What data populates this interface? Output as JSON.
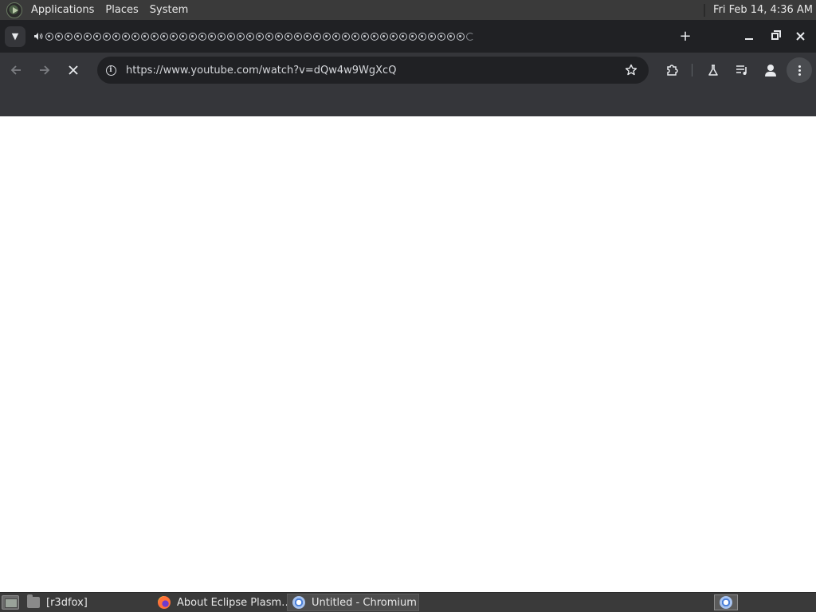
{
  "top_panel": {
    "menus": [
      "Applications",
      "Places",
      "System"
    ],
    "clock": "Fri Feb 14,  4:36 AM"
  },
  "browser": {
    "tab_search_icon": "chevron-down-icon",
    "new_tab_label": "+",
    "tab_count": 45,
    "window_controls": [
      "minimize-icon",
      "maximize-icon",
      "close-icon"
    ]
  },
  "toolbar": {
    "back_icon": "arrow-left-icon",
    "forward_icon": "arrow-right-icon",
    "stop_icon": "close-icon",
    "url": "https://www.youtube.com/watch?v=dQw4w9WgXcQ",
    "site_info_icon": "info-icon",
    "bookmark_icon": "star-icon",
    "extensions_icon": "puzzle-icon",
    "labs_icon": "flask-icon",
    "media_icon": "media-queue-icon",
    "profile_icon": "person-icon",
    "menu_icon": "more-vertical-icon"
  },
  "taskbar": {
    "tasks": [
      {
        "label": "[r3dfox]",
        "icon": "folder-icon",
        "active": false
      },
      {
        "label": "About Eclipse Plasm…",
        "icon": "firefox-icon",
        "active": false
      },
      {
        "label": "Untitled - Chromium",
        "icon": "chromium-icon",
        "active": true
      }
    ],
    "tray_icon": "chromium-icon"
  },
  "colors": {
    "panel": "#3a3a3a",
    "tab_strip": "#202124",
    "toolbar": "#35363a",
    "omnibox": "#202124",
    "page": "#ffffff"
  }
}
